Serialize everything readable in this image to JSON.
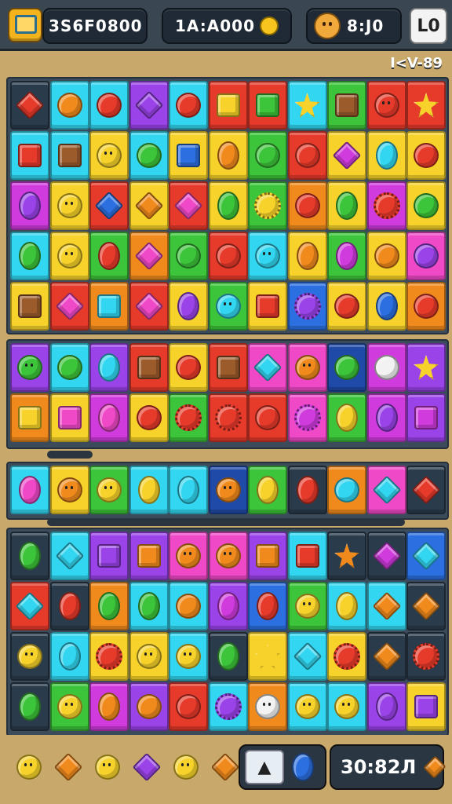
{
  "hud": {
    "score_text": "3S6F0800",
    "coins_text": "1A:A000",
    "lives_text": "8:J0",
    "pause_label": "L0",
    "level_label": "I<V-89"
  },
  "bottom": {
    "timer_text": "30:82Л"
  },
  "colors": {
    "red": "#e63a2a",
    "orange": "#f08a1d",
    "yellow": "#f6d22a",
    "green": "#3cc43a",
    "lime": "#9ee02a",
    "cyan": "#33d6f0",
    "blue": "#2b6fe0",
    "purple": "#9a43e8",
    "pink": "#ef49c8",
    "magenta": "#cf3bdc",
    "navy": "#1f4aa8",
    "dark": "#2a3b4c",
    "teal": "#25b6c7",
    "brown": "#9b5b2b",
    "white": "#f2f2f2",
    "darkred": "#a11f1f"
  },
  "boards": [
    {
      "rows": [
        [
          [
            "dark",
            "red",
            "diamond"
          ],
          [
            "cyan",
            "orange",
            "circle"
          ],
          [
            "cyan",
            "red",
            "circle"
          ],
          [
            "purple",
            "purple",
            "diamond"
          ],
          [
            "cyan",
            "red",
            "circle"
          ],
          [
            "red",
            "yellow",
            "square"
          ],
          [
            "red",
            "green",
            "square"
          ],
          [
            "cyan",
            "yellow",
            "star"
          ],
          [
            "green",
            "brown",
            "square"
          ],
          [
            "red",
            "red",
            "face"
          ],
          [
            "red",
            "yellow",
            "star"
          ]
        ],
        [
          [
            "cyan",
            "red",
            "square"
          ],
          [
            "cyan",
            "brown",
            "square"
          ],
          [
            "yellow",
            "yellow",
            "face"
          ],
          [
            "cyan",
            "green",
            "circle"
          ],
          [
            "yellow",
            "blue",
            "square"
          ],
          [
            "yellow",
            "orange",
            "oval"
          ],
          [
            "green",
            "green",
            "circle"
          ],
          [
            "red",
            "red",
            "circle"
          ],
          [
            "yellow",
            "magenta",
            "diamond"
          ],
          [
            "yellow",
            "cyan",
            "oval"
          ],
          [
            "yellow",
            "red",
            "circle"
          ]
        ],
        [
          [
            "magenta",
            "purple",
            "oval"
          ],
          [
            "yellow",
            "yellow",
            "face"
          ],
          [
            "red",
            "blue",
            "diamond"
          ],
          [
            "yellow",
            "orange",
            "diamond"
          ],
          [
            "red",
            "pink",
            "diamond"
          ],
          [
            "yellow",
            "green",
            "oval"
          ],
          [
            "green",
            "yellow",
            "flower"
          ],
          [
            "orange",
            "red",
            "circle"
          ],
          [
            "yellow",
            "green",
            "oval"
          ],
          [
            "magenta",
            "red",
            "flower"
          ],
          [
            "yellow",
            "green",
            "circle"
          ]
        ],
        [
          [
            "cyan",
            "green",
            "oval"
          ],
          [
            "yellow",
            "yellow",
            "face"
          ],
          [
            "green",
            "red",
            "oval"
          ],
          [
            "orange",
            "pink",
            "diamond"
          ],
          [
            "green",
            "green",
            "circle"
          ],
          [
            "red",
            "red",
            "circle"
          ],
          [
            "cyan",
            "cyan",
            "face"
          ],
          [
            "yellow",
            "orange",
            "oval"
          ],
          [
            "green",
            "magenta",
            "oval"
          ],
          [
            "yellow",
            "orange",
            "circle"
          ],
          [
            "pink",
            "purple",
            "circle"
          ]
        ],
        [
          [
            "yellow",
            "brown",
            "square"
          ],
          [
            "red",
            "pink",
            "diamond"
          ],
          [
            "orange",
            "cyan",
            "square"
          ],
          [
            "red",
            "pink",
            "diamond"
          ],
          [
            "yellow",
            "purple",
            "oval"
          ],
          [
            "green",
            "cyan",
            "face"
          ],
          [
            "yellow",
            "red",
            "square"
          ],
          [
            "blue",
            "purple",
            "flower"
          ],
          [
            "yellow",
            "red",
            "circle"
          ],
          [
            "yellow",
            "blue",
            "oval"
          ],
          [
            "orange",
            "red",
            "circle"
          ]
        ]
      ]
    },
    {
      "rows": [
        [
          [
            "purple",
            "green",
            "face"
          ],
          [
            "cyan",
            "green",
            "circle"
          ],
          [
            "purple",
            "cyan",
            "oval"
          ],
          [
            "red",
            "brown",
            "square"
          ],
          [
            "yellow",
            "red",
            "circle"
          ],
          [
            "red",
            "brown",
            "square"
          ],
          [
            "pink",
            "cyan",
            "diamond"
          ],
          [
            "pink",
            "orange",
            "face"
          ],
          [
            "navy",
            "green",
            "circle"
          ],
          [
            "magenta",
            "white",
            "circle"
          ],
          [
            "purple",
            "yellow",
            "star"
          ]
        ],
        [
          [
            "orange",
            "yellow",
            "square"
          ],
          [
            "yellow",
            "pink",
            "square"
          ],
          [
            "magenta",
            "pink",
            "oval"
          ],
          [
            "yellow",
            "red",
            "circle"
          ],
          [
            "green",
            "red",
            "flower"
          ],
          [
            "red",
            "red",
            "flower"
          ],
          [
            "red",
            "red",
            "circle"
          ],
          [
            "pink",
            "magenta",
            "flower"
          ],
          [
            "green",
            "yellow",
            "oval"
          ],
          [
            "magenta",
            "purple",
            "oval"
          ],
          [
            "purple",
            "magenta",
            "square"
          ]
        ]
      ]
    },
    {
      "rows": [
        [
          [
            "cyan",
            "pink",
            "oval"
          ],
          [
            "yellow",
            "orange",
            "face"
          ],
          [
            "green",
            "yellow",
            "face"
          ],
          [
            "cyan",
            "yellow",
            "oval"
          ],
          [
            "cyan",
            "cyan",
            "oval"
          ],
          [
            "navy",
            "orange",
            "face"
          ],
          [
            "green",
            "yellow",
            "oval"
          ],
          [
            "dark",
            "red",
            "oval"
          ],
          [
            "orange",
            "cyan",
            "circle"
          ],
          [
            "pink",
            "cyan",
            "diamond"
          ],
          [
            "dark",
            "red",
            "diamond"
          ]
        ]
      ]
    },
    {
      "rows": [
        [
          [
            "dark",
            "green",
            "oval"
          ],
          [
            "cyan",
            "cyan",
            "diamond"
          ],
          [
            "purple",
            "purple",
            "square"
          ],
          [
            "purple",
            "orange",
            "square"
          ],
          [
            "pink",
            "orange",
            "face"
          ],
          [
            "pink",
            "orange",
            "face"
          ],
          [
            "purple",
            "orange",
            "square"
          ],
          [
            "cyan",
            "red",
            "square"
          ],
          [
            "dark",
            "orange",
            "star"
          ],
          [
            "dark",
            "magenta",
            "diamond"
          ],
          [
            "blue",
            "cyan",
            "diamond"
          ]
        ],
        [
          [
            "red",
            "cyan",
            "diamond"
          ],
          [
            "dark",
            "red",
            "oval"
          ],
          [
            "orange",
            "green",
            "oval"
          ],
          [
            "cyan",
            "green",
            "oval"
          ],
          [
            "cyan",
            "orange",
            "circle"
          ],
          [
            "purple",
            "magenta",
            "oval"
          ],
          [
            "blue",
            "red",
            "oval"
          ],
          [
            "green",
            "yellow",
            "face"
          ],
          [
            "cyan",
            "yellow",
            "oval"
          ],
          [
            "cyan",
            "orange",
            "diamond"
          ],
          [
            "dark",
            "orange",
            "diamond"
          ]
        ],
        [
          [
            "dark",
            "yellow",
            "face"
          ],
          [
            "cyan",
            "cyan",
            "oval"
          ],
          [
            "yellow",
            "red",
            "flower"
          ],
          [
            "yellow",
            "yellow",
            "face"
          ],
          [
            "cyan",
            "yellow",
            "face"
          ],
          [
            "dark",
            "green",
            "oval"
          ],
          [
            "yellow",
            "yellow",
            "star"
          ],
          [
            "cyan",
            "cyan",
            "diamond"
          ],
          [
            "yellow",
            "red",
            "flower"
          ],
          [
            "dark",
            "orange",
            "diamond"
          ],
          [
            "dark",
            "red",
            "flower"
          ]
        ],
        [
          [
            "dark",
            "green",
            "oval"
          ],
          [
            "green",
            "yellow",
            "face"
          ],
          [
            "magenta",
            "orange",
            "oval"
          ],
          [
            "purple",
            "orange",
            "circle"
          ],
          [
            "red",
            "red",
            "circle"
          ],
          [
            "cyan",
            "purple",
            "flower"
          ],
          [
            "orange",
            "white",
            "face"
          ],
          [
            "cyan",
            "yellow",
            "face"
          ],
          [
            "cyan",
            "yellow",
            "face"
          ],
          [
            "purple",
            "purple",
            "oval"
          ],
          [
            "yellow",
            "purple",
            "square"
          ]
        ]
      ]
    }
  ],
  "bottom_gems": [
    [
      "yellow",
      "face"
    ],
    [
      "orange",
      "diamond"
    ],
    [
      "yellow",
      "face"
    ],
    [
      "purple",
      "diamond"
    ],
    [
      "yellow",
      "face"
    ],
    [
      "orange",
      "diamond"
    ]
  ]
}
